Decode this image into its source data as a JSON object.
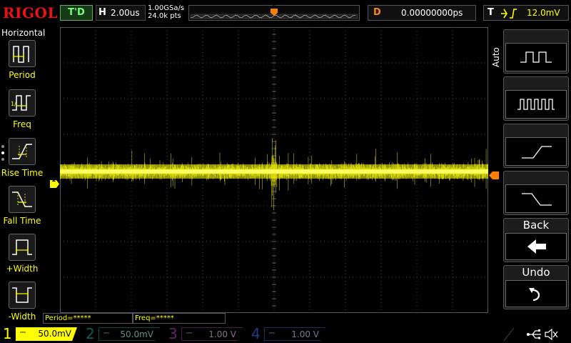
{
  "header": {
    "logo": "RIGOL",
    "status": "T'D",
    "horizontal": {
      "label": "H",
      "value": "2.00us"
    },
    "sample_rate": "1.00GSa/s",
    "memory_depth": "24.0k pts",
    "trigger_marker": "T",
    "delay": {
      "label": "D",
      "value": "0.00000000ps"
    },
    "trigger": {
      "label": "T",
      "value": "12.0mV"
    }
  },
  "left_menu": {
    "title": "Horizontal",
    "items": [
      {
        "label": "Period"
      },
      {
        "label": "Freq"
      },
      {
        "label": "Rise Time"
      },
      {
        "label": "Fall Time"
      },
      {
        "label": "+Width"
      },
      {
        "label": "-Width"
      }
    ]
  },
  "right_menu": {
    "auto_label": "Auto",
    "back_label": "Back",
    "undo_label": "Undo"
  },
  "measurements": {
    "period": "Period=*****",
    "freq": "Freq=*****"
  },
  "channel_marker": "1",
  "channels": [
    {
      "num": "1",
      "scale": "50.0mV",
      "color": "#ffff00",
      "active": true
    },
    {
      "num": "2",
      "scale": "50.0mV",
      "color": "#00bfa5",
      "active": false
    },
    {
      "num": "3",
      "scale": "1.00 V",
      "color": "#d040d0",
      "active": false
    },
    {
      "num": "4",
      "scale": "1.00 V",
      "color": "#3b7bff",
      "active": false
    }
  ],
  "colors": {
    "trace": "#ffff00",
    "accent": "#ff8000"
  }
}
